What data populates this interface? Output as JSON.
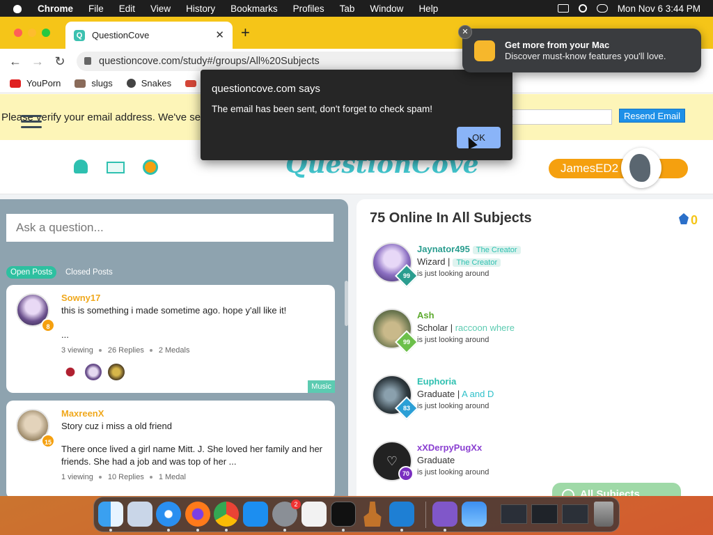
{
  "menubar": {
    "app": "Chrome",
    "items": [
      "File",
      "Edit",
      "View",
      "History",
      "Bookmarks",
      "Profiles",
      "Tab",
      "Window",
      "Help"
    ],
    "clock": "Mon Nov 6  3:44 PM"
  },
  "browser": {
    "tab_title": "QuestionCove",
    "tab_favicon": "Q",
    "url": "questioncove.com/study#/groups/All%20Subjects",
    "bookmarks": [
      {
        "label": "YouPorn",
        "color": "#e02020"
      },
      {
        "label": "slugs",
        "color": "#8a6b5a"
      },
      {
        "label": "Snakes",
        "color": "#444444"
      },
      {
        "label": "Gr",
        "color": "#d44638"
      }
    ]
  },
  "verify_banner": {
    "text": "Please verify your email address. We've sen",
    "email_value": "e",
    "resend_label": "Resend Email"
  },
  "header": {
    "logo_text": "QuestionCove",
    "username": "JamesED2",
    "accent": "#f5a00f",
    "teal": "#2ec0c9"
  },
  "left_panel": {
    "ask_placeholder": "Ask a question...",
    "open_posts_label": "Open Posts",
    "closed_posts_label": "Closed Posts",
    "posts": [
      {
        "author": "Sowny17",
        "level": "8",
        "title": "this is something i made sometime ago. hope y'all like it!",
        "body": "...",
        "viewing": "3 viewing",
        "replies": "26 Replies",
        "medals": "2 Medals",
        "tag": "Music"
      },
      {
        "author": "MaxreenX",
        "level": "15",
        "title": "Story cuz i miss a old friend",
        "body": "There once lived a girl name Mitt. J. She loved her family and her friends. She had a job and was top of her ...",
        "viewing": "1 viewing",
        "replies": "10 Replies",
        "medals": "1 Medal"
      }
    ]
  },
  "right_panel": {
    "title": "75 Online In All Subjects",
    "crown_count": "0",
    "all_subjects_label": "All Subjects",
    "users": [
      {
        "name": "Jaynator495",
        "badge": "The Creator",
        "rank": "Wizard |",
        "rank_badge": "The Creator",
        "status": "is just looking around",
        "level": "99",
        "name_color": "#2a9d8f",
        "level_color": "#2a9d8f",
        "avatar_color": "#6b4fa3"
      },
      {
        "name": "Ash",
        "badge": "",
        "rank": "Scholar |",
        "rank_badge": "raccoon where",
        "status": "is just looking around",
        "level": "99",
        "name_color": "#5daa2e",
        "level_color": "#6cc04a",
        "avatar_color": "#6f7a52"
      },
      {
        "name": "Euphoria",
        "badge": "",
        "rank": "Graduate |",
        "rank_badge": "A and D",
        "status": "is just looking around",
        "level": "83",
        "name_color": "#2ec0b0",
        "level_color": "#2a9fd6",
        "avatar_color": "#2f3a40"
      },
      {
        "name": "xXDerpyPugXx",
        "badge": "",
        "rank": "Graduate",
        "rank_badge": "",
        "status": "is just looking around",
        "level": "70",
        "name_color": "#8a3fd1",
        "level_color": "#7a2fc0",
        "avatar_color": "#222222"
      }
    ]
  },
  "dialog": {
    "title": "questioncove.com says",
    "message": "The email has been sent, don't forget to check spam!",
    "ok_label": "OK"
  },
  "notification": {
    "title": "Get more from your Mac",
    "message": "Discover must-know features you'll love."
  },
  "dock": {
    "apps": [
      "finder-icon",
      "launchpad-icon",
      "safari-icon",
      "firefox-icon",
      "chrome-icon",
      "app-store-icon",
      "system-settings-icon",
      "textedit-icon",
      "terminal-icon",
      "garageband-icon",
      "vscode-icon",
      "visual-studio-icon",
      "weather-icon"
    ],
    "settings_badge": "2"
  }
}
